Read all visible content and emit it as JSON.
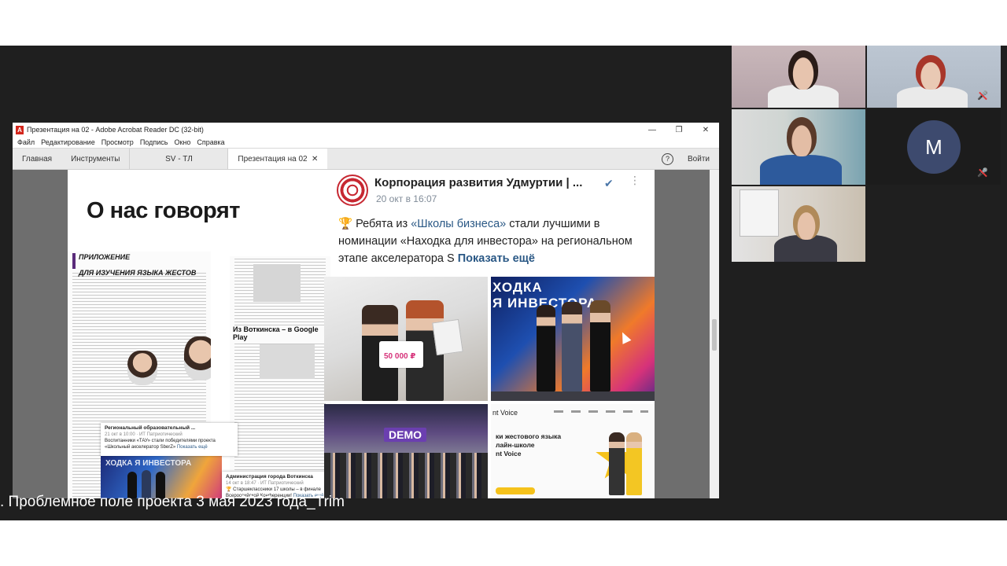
{
  "window": {
    "title": "Презентация на 02 - Adobe Acrobat Reader DC (32-bit)",
    "logo_letter": "A",
    "minimize": "—",
    "maximize": "❐",
    "close": "✕"
  },
  "menu": [
    "Файл",
    "Редактирование",
    "Просмотр",
    "Подпись",
    "Окно",
    "Справка"
  ],
  "tabs": {
    "home": "Главная",
    "tools": "Инструменты",
    "doc1": "SV - ТЛ",
    "doc2": "Презентация на 02",
    "doc2_close": "✕",
    "help": "?",
    "signin": "Войти"
  },
  "slide": {
    "title": "О нас говорят",
    "newspaper1_header_line1": "ПРИЛОЖЕНИЕ",
    "newspaper1_header_line2": "ДЛЯ ИЗУЧЕНИЯ ЯЗЫКА ЖЕСТОВ",
    "newspaper2_caption": "Из Воткинска – в Google Play",
    "card1": {
      "name": "Региональный образовательный ...",
      "meta": "21 окт в 10:00 · ИТ Патриотический",
      "text": "Воспитанники «ТАУ» стали победителями проекта «Школьный акселератор SberZ»",
      "more": "Показать ещё"
    },
    "card2": {
      "name": "Администрация города Воткинска",
      "meta": "14 окт в 18:47 · ИТ Патриотический",
      "text": "🏆 Старшеклассники 17 школы – в финале Всероссийской Конференции!",
      "more": "Показать ещё"
    },
    "mini_slide_text": "ХОДКА Я ИНВЕСТОРА"
  },
  "post": {
    "author": "Корпорация развития Удмуртии | ...",
    "verified": "✔",
    "menu_dots": "⋮",
    "date": "20 окт в 16:07",
    "text_icon": "🏆",
    "text_1": " Ребята из ",
    "link": "«Школы бизнеса»",
    "text_2": " стали лучшими в номинации «Находка для инвестора» на региональном этапе акселератора S",
    "more": "Показать ещё"
  },
  "photos": {
    "sign_value": "50 000 ₽",
    "banner_text_line1": "ХОДКА",
    "banner_text_line2": "Я ИНВЕСТОРА",
    "demo_text": "DEMO",
    "brand_text": "nt Voice",
    "promo_line1": "ки жестового языка",
    "promo_line2": "лайн-школе",
    "promo_line3": "nt Voice"
  },
  "caption": ". Проблемное поле проекта 3 мая 2023 года_Trim",
  "participants": {
    "avatar_letter": "M",
    "muted_icon": "mic-off-icon"
  },
  "colors": {
    "stage": "#1f1f1f",
    "acrobat_red": "#d3261c",
    "vk_link": "#2a5885",
    "avatar": "#3d4a6e",
    "muted": "#e23d3d"
  }
}
